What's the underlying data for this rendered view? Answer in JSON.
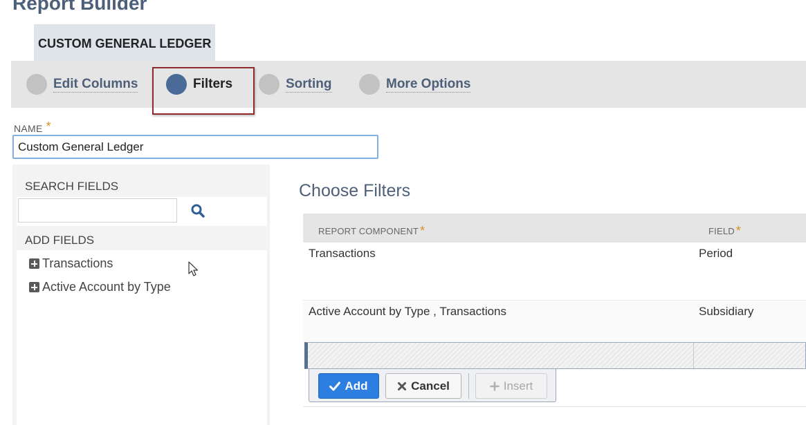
{
  "page": {
    "title": "Report Builder"
  },
  "report_tab": {
    "label": "CUSTOM GENERAL LEDGER"
  },
  "steps": [
    {
      "label": "Edit Columns",
      "active": false
    },
    {
      "label": "Filters",
      "active": true
    },
    {
      "label": "Sorting",
      "active": false
    },
    {
      "label": "More Options",
      "active": false
    }
  ],
  "name_field": {
    "label": "NAME",
    "required_mark": "*",
    "value": "Custom General Ledger"
  },
  "field_panel": {
    "search_label": "SEARCH FIELDS",
    "search_value": "",
    "add_label": "ADD FIELDS",
    "tree": [
      {
        "label": "Transactions"
      },
      {
        "label": "Active Account by Type"
      }
    ]
  },
  "filters": {
    "title": "Choose Filters",
    "columns": [
      {
        "label": "REPORT COMPONENT",
        "required_mark": "*"
      },
      {
        "label": "FIELD",
        "required_mark": "*"
      }
    ],
    "rows": [
      {
        "component": "Transactions",
        "field": "Period"
      },
      {
        "component": "Active Account by Type , Transactions",
        "field": "Subsidiary"
      }
    ],
    "buttons": {
      "add": "Add",
      "cancel": "Cancel",
      "insert": "Insert"
    }
  },
  "colors": {
    "accent_blue": "#2c7fe0",
    "active_step": "#4a6b97",
    "required": "#d8901e",
    "highlight_border": "#8e2a2a"
  }
}
